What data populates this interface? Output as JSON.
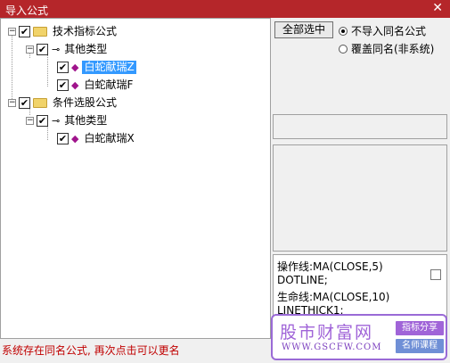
{
  "window": {
    "title": "导入公式",
    "close_glyph": "✕"
  },
  "tree": {
    "root1": {
      "label": "技术指标公式"
    },
    "root1_child": {
      "label": "其他类型"
    },
    "root1_leaf1": {
      "label": "白蛇献瑞Z",
      "selected": true
    },
    "root1_leaf2": {
      "label": "白蛇献瑞F"
    },
    "root2": {
      "label": "条件选股公式"
    },
    "root2_child": {
      "label": "其他类型"
    },
    "root2_leaf1": {
      "label": "白蛇献瑞X"
    },
    "expander_glyph": "−",
    "check_glyph": "✔",
    "key_glyph": "⊸",
    "gem_glyph": "◆"
  },
  "options": {
    "select_all_label": "全部选中",
    "radio_no_import": "不导入同名公式",
    "radio_overwrite": "覆盖同名(非系统)"
  },
  "code_lines": [
    "操作线:MA(CLOSE,5)",
    "DOTLINE;",
    "生命线:MA(CLOSE,10)",
    "LINETHICK1;"
  ],
  "status_text": "系统存在同名公式, 再次点击可以更名",
  "watermark": {
    "brand": "股市财富网",
    "url": "WWW.GSCFW.COM",
    "tag1": "指标分享",
    "tag2": "名师课程"
  },
  "colors": {
    "titlebar": "#b5262a",
    "selection": "#3399ff",
    "status": "#c00000",
    "watermark": "#a064d8"
  }
}
